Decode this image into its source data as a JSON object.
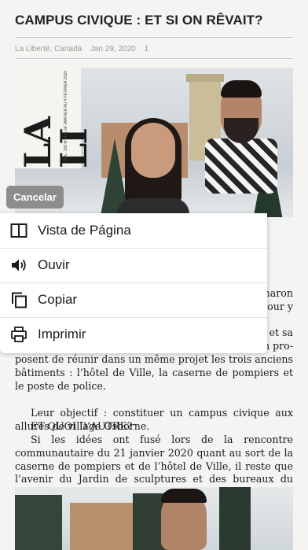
{
  "article": {
    "title": "CAMPUS CIVIQUE : ET SI ON RÊVAIT?",
    "source": "La Liberté, Canadá",
    "date": "Jan 29, 2020",
    "page": "1",
    "magazine_logo": "LA LI",
    "magazine_issue": "VOL. 106 N° 43 | 29 JANVIER AU 4 FÉVRIER 2020",
    "right_fragments": [
      "haron",
      "pour y",
      "et sa",
      "n pro-"
    ],
    "paragraphs": [
      "posent de réunir dans un même projet les trois anciens bâtiments : l’hôtel de Ville, la caserne de pompiers et le poste de police.",
      "Leur objectif : constituer un campus civique aux allures de village Osborne.",
      "ET QUOI D’AUTRE?",
      "Si les idées ont fusé lors de la rencontre communautaire du 21 janvier 2020 quant au sort de la caserne de pompiers et de l’hôtel de Ville, il reste que l’avenir du Jardin de sculptures et des bureaux du Festival du Voyageur est aussi en suspens."
    ]
  },
  "action_sheet": {
    "cancel_label": "Cancelar",
    "items": [
      {
        "label": "Vista de Página",
        "icon": "book-open-icon"
      },
      {
        "label": "Ouvir",
        "icon": "speaker-icon"
      },
      {
        "label": "Copiar",
        "icon": "copy-icon"
      },
      {
        "label": "Imprimir",
        "icon": "printer-icon"
      }
    ]
  },
  "colors": {
    "background": "#f4f4f2",
    "cancel_button": "#8d8d8d",
    "menu_background": "#ffffff",
    "text": "#1c1c1c",
    "meta_text": "#9a9a96"
  }
}
